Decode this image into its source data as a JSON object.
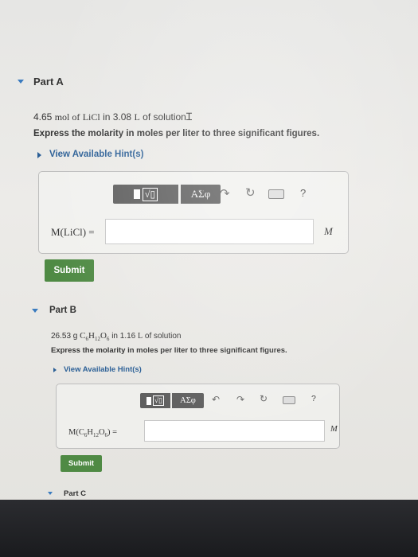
{
  "part_a": {
    "title": "Part A",
    "problem_qty": "4.65",
    "problem_unit": "mol of",
    "problem_compound": "LiCl",
    "problem_in": "in 3.08",
    "problem_vol_unit": "L",
    "problem_tail": "of solution",
    "instruction": "Express the molarity in moles per liter to three significant figures.",
    "hint_link": "View Available Hint(s)",
    "toolbar_greek": "ΑΣφ",
    "toolbar_help": "?",
    "answer_label": "M(LiCl) =",
    "answer_value": "",
    "unit": "M",
    "submit_label": "Submit"
  },
  "part_b": {
    "title": "Part B",
    "problem_qty": "26.53 g",
    "problem_compound": "C6H12O6",
    "problem_in": "in 1.16",
    "problem_vol_unit": "L",
    "problem_tail": "of solution",
    "instruction": "Express the molarity in moles per liter to three significant figures.",
    "hint_link": "View Available Hint(s)",
    "toolbar_greek": "ΑΣφ",
    "toolbar_help": "?",
    "answer_label_prefix": "M(C",
    "answer_label_suffix": ") =",
    "answer_value": "",
    "unit": "M",
    "submit_label": "Submit"
  },
  "part_c": {
    "title": "Part C"
  }
}
